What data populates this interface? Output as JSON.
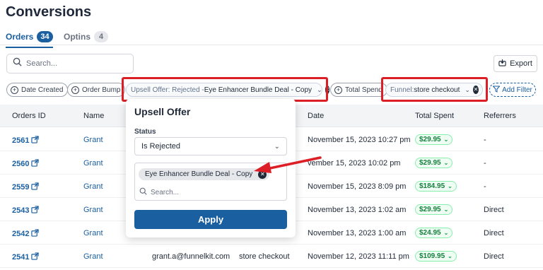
{
  "page": {
    "title": "Conversions"
  },
  "tabs": [
    {
      "label": "Orders",
      "count": "34"
    },
    {
      "label": "Optins",
      "count": "4"
    }
  ],
  "search": {
    "placeholder": "Search..."
  },
  "export": {
    "label": "Export"
  },
  "filters": {
    "date_created": "Date Created",
    "order_bump": "Order Bump",
    "upsell_key": "Upsell Offer: Rejected - ",
    "upsell_value": "Eye Enhancer Bundle Deal - Copy",
    "total_spend": "Total Spend",
    "funnel_key": "Funnel: ",
    "funnel_value": "store checkout",
    "add_filter": "Add Filter"
  },
  "table": {
    "headers": [
      "Orders ID",
      "Name",
      "Date",
      "Total Spent",
      "Referrers"
    ],
    "rows": [
      {
        "id": "2561",
        "name": "Grant",
        "email": "",
        "funnel": "",
        "date": "November 15, 2023 10:27 pm",
        "spent": "$29.95",
        "referrer": "-"
      },
      {
        "id": "2560",
        "name": "Grant",
        "email": "",
        "funnel": "",
        "date": "vember 15, 2023 10:02 pm",
        "spent": "$29.95",
        "referrer": "-"
      },
      {
        "id": "2559",
        "name": "Grant",
        "email": "",
        "funnel": "",
        "date": "November 15, 2023 8:09 pm",
        "spent": "$184.95",
        "referrer": "-"
      },
      {
        "id": "2543",
        "name": "Grant",
        "email": "",
        "funnel": "",
        "date": "November 13, 2023 1:02 am",
        "spent": "$29.95",
        "referrer": "Direct"
      },
      {
        "id": "2542",
        "name": "Grant",
        "email": "",
        "funnel": "",
        "date": "November 13, 2023 1:00 am",
        "spent": "$24.95",
        "referrer": "Direct"
      },
      {
        "id": "2541",
        "name": "Grant",
        "email": "grant.a@funnelkit.com",
        "funnel": "store checkout",
        "date": "November 12, 2023 11:11 pm",
        "spent": "$109.95",
        "referrer": "Direct"
      }
    ]
  },
  "popover": {
    "title": "Upsell Offer",
    "status_label": "Status",
    "status_value": "Is Rejected",
    "selected_value": "Eye Enhancer Bundle Deal - Copy",
    "search_placeholder": "Search...",
    "apply_label": "Apply"
  },
  "colors": {
    "accent": "#1a5fa0",
    "highlight": "#dc1f26",
    "money": "#15803d"
  }
}
